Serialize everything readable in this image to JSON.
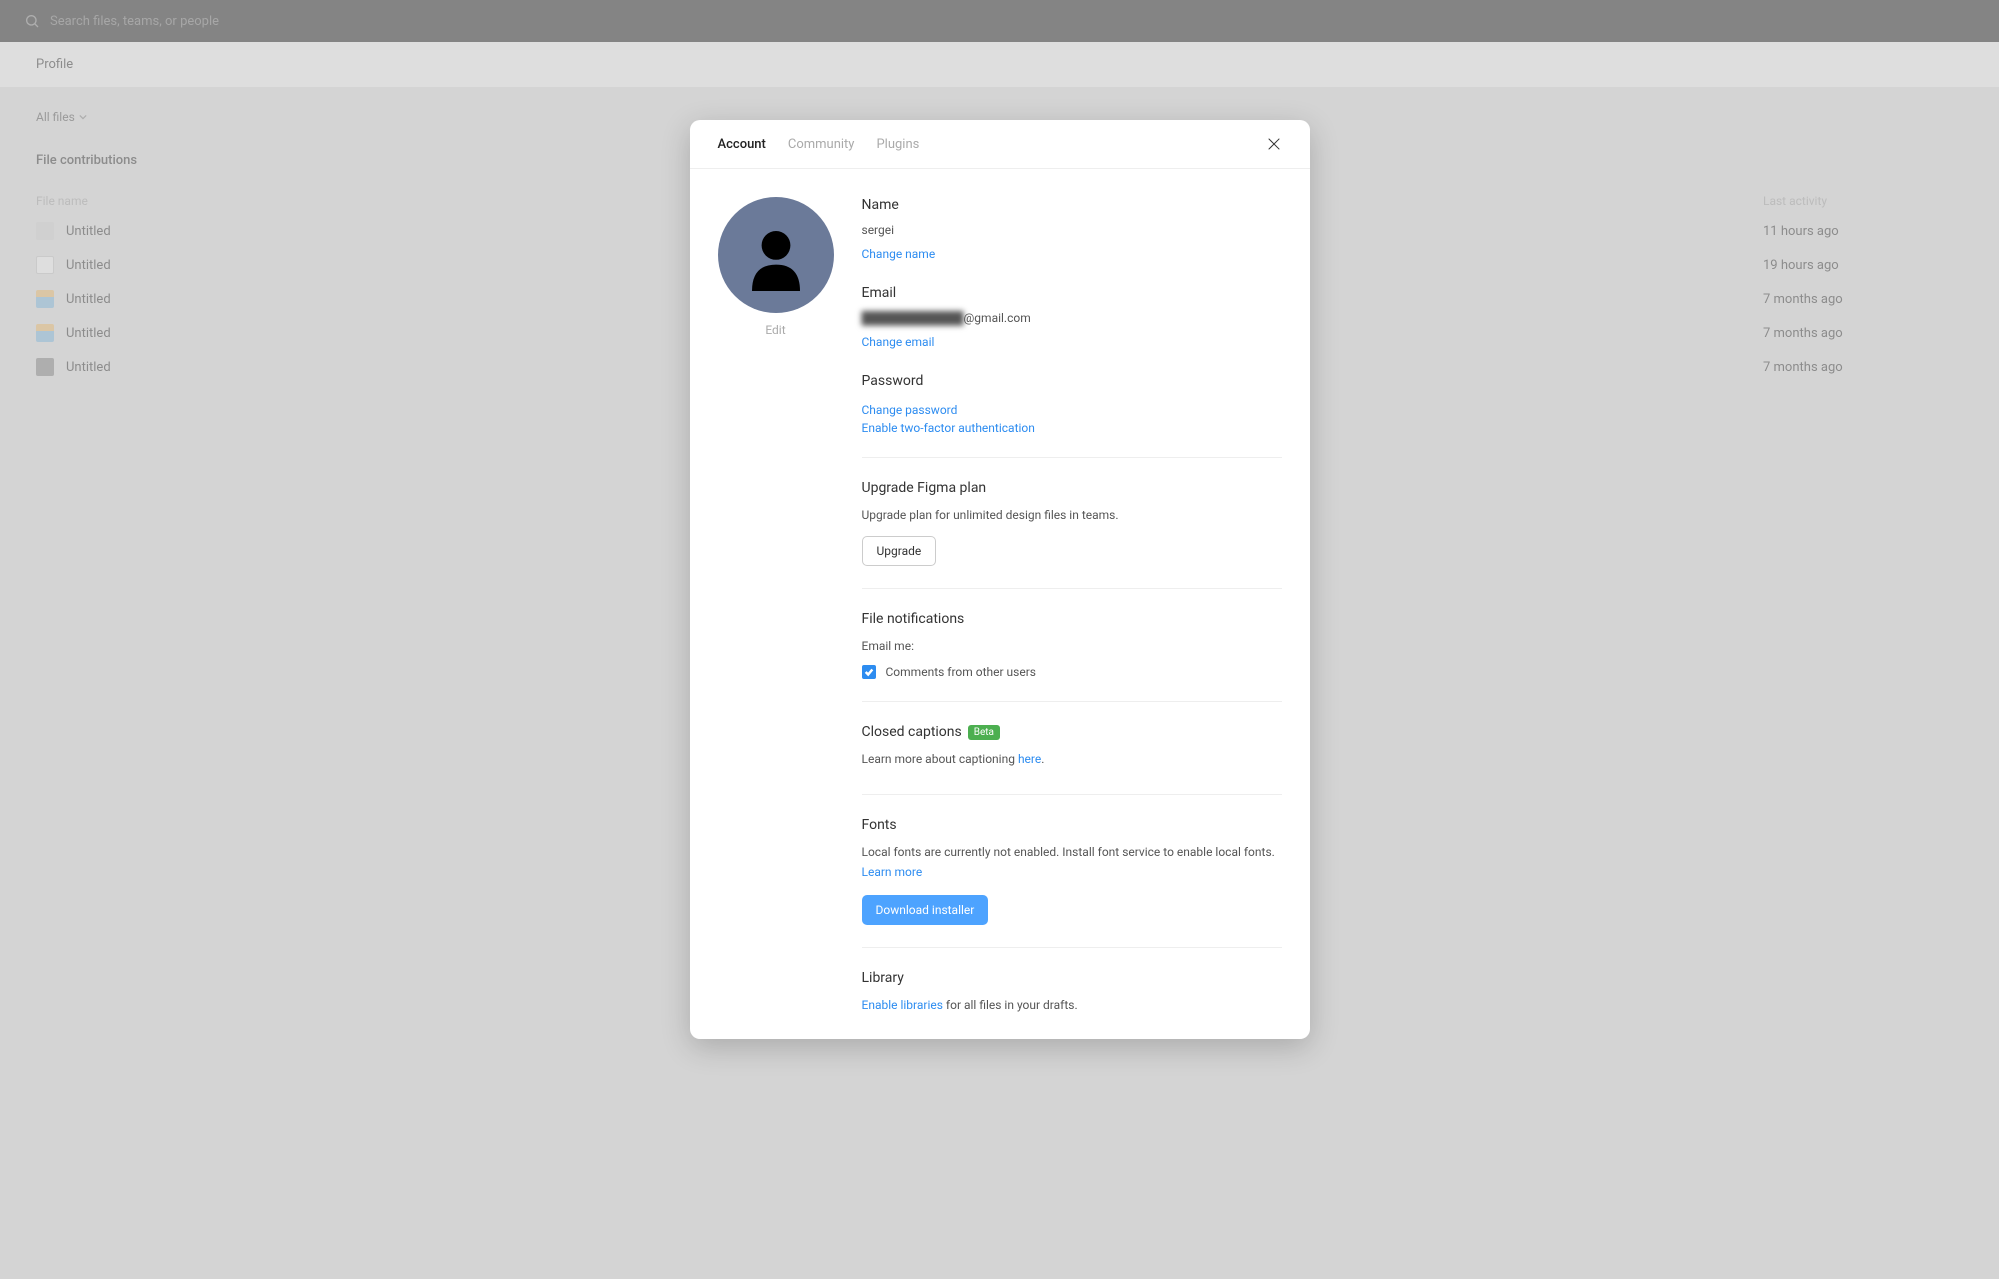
{
  "search": {
    "placeholder": "Search files, teams, or people"
  },
  "profile_label": "Profile",
  "filter": {
    "label": "All files"
  },
  "section_title": "File contributions",
  "columns": {
    "name": "File name",
    "activity": "Last activity"
  },
  "files": [
    {
      "name": "Untitled",
      "activity": "11 hours ago",
      "thumb": "a"
    },
    {
      "name": "Untitled",
      "activity": "19 hours ago",
      "thumb": "b"
    },
    {
      "name": "Untitled",
      "activity": "7 months ago",
      "thumb": "c"
    },
    {
      "name": "Untitled",
      "activity": "7 months ago",
      "thumb": "c"
    },
    {
      "name": "Untitled",
      "activity": "7 months ago",
      "thumb": "d"
    }
  ],
  "modal": {
    "tabs": {
      "account": "Account",
      "community": "Community",
      "plugins": "Plugins"
    },
    "avatar": {
      "edit": "Edit"
    },
    "name": {
      "label": "Name",
      "value": "sergei",
      "change": "Change name"
    },
    "email": {
      "label": "Email",
      "value_hidden": "████████████",
      "value_suffix": "@gmail.com",
      "change": "Change email"
    },
    "password": {
      "label": "Password",
      "change": "Change password",
      "twofa": "Enable two-factor authentication"
    },
    "upgrade": {
      "heading": "Upgrade Figma plan",
      "text": "Upgrade plan for unlimited design files in teams.",
      "button": "Upgrade"
    },
    "notifications": {
      "heading": "File notifications",
      "text": "Email me:",
      "checkbox": "Comments from other users"
    },
    "captions": {
      "heading": "Closed captions",
      "badge": "Beta",
      "text": "Learn more about captioning ",
      "link": "here",
      "suffix": "."
    },
    "fonts": {
      "heading": "Fonts",
      "text": "Local fonts are currently not enabled. Install font service to enable local fonts.",
      "learn": "Learn more",
      "button": "Download installer"
    },
    "library": {
      "heading": "Library",
      "link": "Enable libraries",
      "text": " for all files in your drafts."
    }
  }
}
